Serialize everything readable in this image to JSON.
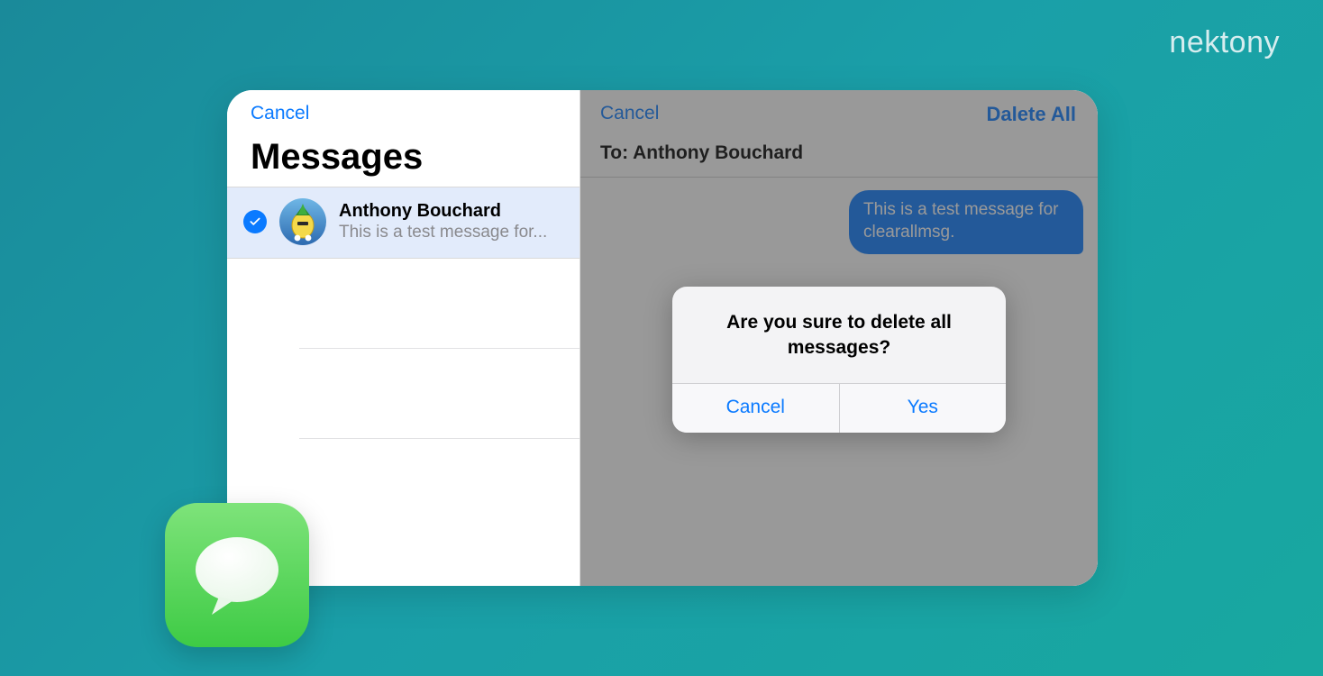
{
  "brand": "nektony",
  "left": {
    "cancel": "Cancel",
    "title": "Messages",
    "conversation": {
      "name": "Anthony Bouchard",
      "preview": "This is a test message for..."
    }
  },
  "right": {
    "cancel": "Cancel",
    "deleteAll": "Dalete All",
    "toLabel": "To: Anthony Bouchard",
    "bubble": "This is a test message for clearallmsg."
  },
  "alert": {
    "message": "Are you sure to delete all messages?",
    "cancel": "Cancel",
    "yes": "Yes"
  }
}
